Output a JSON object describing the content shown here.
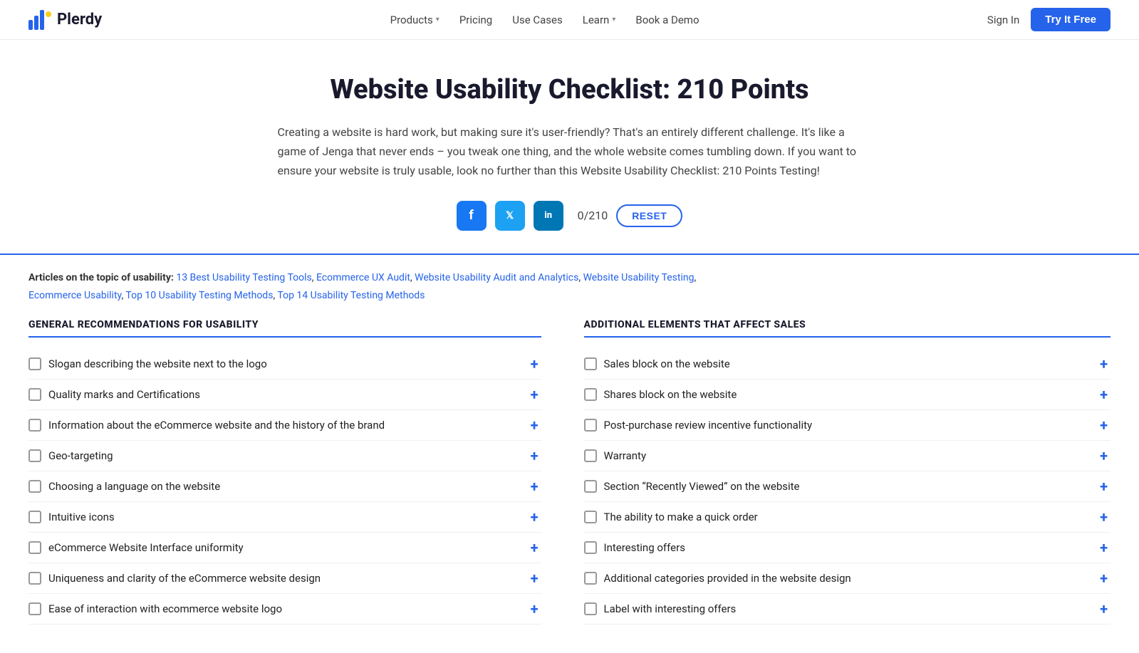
{
  "nav": {
    "logo_text": "Plerdy",
    "links": [
      {
        "label": "Products",
        "has_dropdown": true
      },
      {
        "label": "Pricing",
        "has_dropdown": false
      },
      {
        "label": "Use Cases",
        "has_dropdown": false
      },
      {
        "label": "Learn",
        "has_dropdown": true
      },
      {
        "label": "Book a Demo",
        "has_dropdown": false
      }
    ],
    "sign_in": "Sign In",
    "try_free": "Try It Free"
  },
  "hero": {
    "title": "Website Usability Checklist: 210 Points",
    "description": "Creating a website is hard work, but making sure it's user-friendly? That's an entirely different challenge. It's like a game of Jenga that never ends – you tweak one thing, and the whole website comes tumbling down. If you want to ensure your website is truly usable, look no further than this Website Usability Checklist: 210 Points Testing!"
  },
  "social": {
    "counter": "0/210",
    "reset_label": "RESET",
    "fb_label": "f",
    "tw_label": "🐦",
    "li_label": "in"
  },
  "articles": {
    "prefix": "Articles on the topic of usability:",
    "links": [
      "13 Best Usability Testing Tools",
      "Ecommerce UX Audit",
      "Website Usability Audit and Analytics",
      "Website Usability Testing",
      "Ecommerce Usability",
      "Top 10 Usability Testing Methods",
      "Top 14 Usability Testing Methods"
    ]
  },
  "left_col": {
    "header": "GENERAL RECOMMENDATIONS FOR USABILITY",
    "items": [
      "Slogan describing the website next to the logo",
      "Quality marks and Certifications",
      "Information about the eCommerce website and the history of the brand",
      "Geo-targeting",
      "Choosing a language on the website",
      "Intuitive icons",
      "eCommerce Website Interface uniformity",
      "Uniqueness and clarity of the eCommerce website design",
      "Ease of interaction with ecommerce website logo"
    ]
  },
  "right_col": {
    "header": "ADDITIONAL ELEMENTS THAT AFFECT SALES",
    "items": [
      "Sales block on the website",
      "Shares block on the website",
      "Post-purchase review incentive functionality",
      "Warranty",
      "Section “Recently Viewed” on the website",
      "The ability to make a quick order",
      "Interesting offers",
      "Additional categories provided in the website design",
      "Label with interesting offers"
    ]
  }
}
